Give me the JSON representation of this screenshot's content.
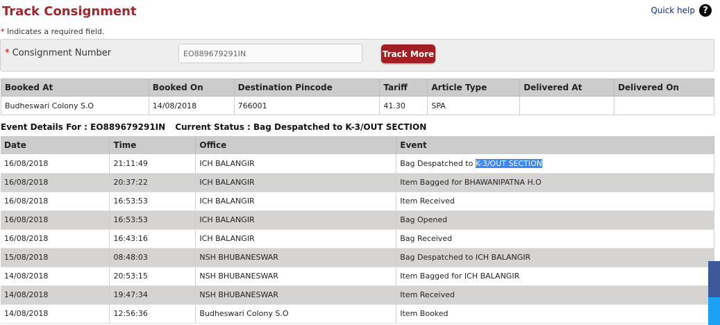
{
  "page": {
    "title": "Track Consignment",
    "quick_help": "Quick help",
    "help_icon_glyph": "?",
    "required_star": "*",
    "required_note": " Indicates a required field."
  },
  "form": {
    "label_star": "*",
    "label": " Consignment Number",
    "value": "EO889679291IN",
    "button": "Track More"
  },
  "booking": {
    "headers": [
      "Booked At",
      "Booked On",
      "Destination Pincode",
      "Tariff",
      "Article Type",
      "Delivered At",
      "Delivered On"
    ],
    "row": [
      "Budheswari Colony S.O",
      "14/08/2018",
      "766001",
      "41.30",
      "SPA",
      "",
      ""
    ]
  },
  "event_details": {
    "for_label": "Event Details For : EO889679291IN",
    "status_label": "Current Status : Bag Despatched to K-3/OUT SECTION"
  },
  "events": {
    "headers": [
      "Date",
      "Time",
      "Office",
      "Event"
    ],
    "first_event_prefix": "Bag Despatched to ",
    "first_event_selected": "K-3/OUT SECTION",
    "rows": [
      [
        "16/08/2018",
        "21:11:49",
        "ICH BALANGIR",
        ""
      ],
      [
        "16/08/2018",
        "20:37:22",
        "ICH BALANGIR",
        "Item Bagged for BHAWANIPATNA H.O"
      ],
      [
        "16/08/2018",
        "16:53:53",
        "ICH BALANGIR",
        "Item Received"
      ],
      [
        "16/08/2018",
        "16:53:53",
        "ICH BALANGIR",
        "Bag Opened"
      ],
      [
        "16/08/2018",
        "16:43:16",
        "ICH BALANGIR",
        "Bag Received"
      ],
      [
        "15/08/2018",
        "08:48:03",
        "NSH BHUBANESWAR",
        "Bag Despatched to ICH BALANGIR"
      ],
      [
        "14/08/2018",
        "20:53:15",
        "NSH BHUBANESWAR",
        "Item Bagged for ICH BALANGIR"
      ],
      [
        "14/08/2018",
        "19:47:34",
        "NSH BHUBANESWAR",
        "Item Received"
      ],
      [
        "14/08/2018",
        "12:56:36",
        "Budheswari Colony S.O",
        "Item Booked"
      ]
    ]
  },
  "colors": {
    "title": "#a3262a",
    "button": "#a31e22",
    "header_bg": "#cccccc",
    "alt_row": "#d6d3d3",
    "selection": "#3b86ff"
  }
}
